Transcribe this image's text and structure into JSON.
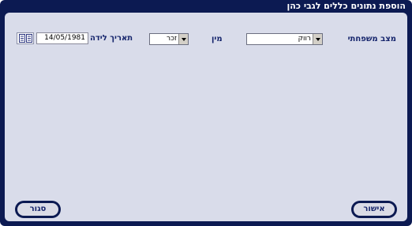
{
  "window": {
    "title": "הוספת נתונים כללים לגבי כהן"
  },
  "form": {
    "marital_status": {
      "label": "מצב משפחתי",
      "value": "רווק"
    },
    "gender": {
      "label": "מין",
      "value": "זכר"
    },
    "birth_date": {
      "label": "תאריך לידה",
      "value": "14/05/1981"
    }
  },
  "buttons": {
    "confirm": "אישור",
    "close": "סגור"
  },
  "colors": {
    "frame": "#0c1a52",
    "panel": "#d9dcea",
    "label": "#14236b"
  },
  "icons": {
    "calendar_button": "calendar-icon",
    "dropdown": "chevron-down-icon"
  }
}
